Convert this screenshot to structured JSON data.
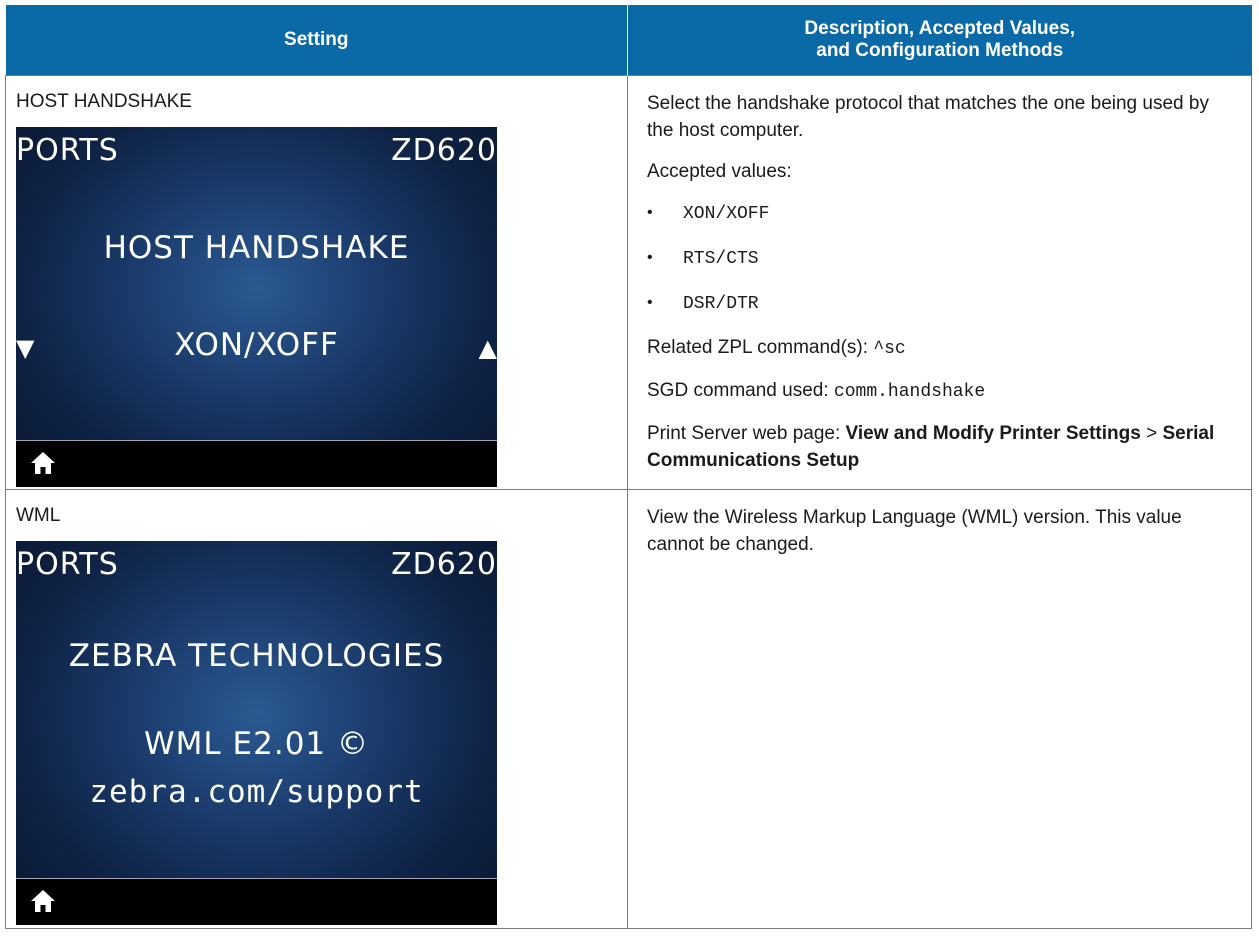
{
  "header": {
    "col1": "Setting",
    "col2_line1": "Description, Accepted Values,",
    "col2_line2": "and Configuration Methods"
  },
  "rows": [
    {
      "setting": "HOST HANDSHAKE",
      "screen": {
        "top_left": "PORTS",
        "top_right": "ZD620",
        "title": "HOST HANDSHAKE",
        "value": "XON/XOFF",
        "left_arrow": "▼",
        "right_arrow": "▲"
      },
      "description": "Select the handshake protocol that matches the one being used by the host computer.",
      "accepted_label": "Accepted values:",
      "values": [
        "XON/XOFF",
        "RTS/CTS",
        "DSR/DTR"
      ],
      "zpl_label": "Related ZPL command(s): ",
      "zpl_cmd": "^sc",
      "sgd_label": "SGD command used: ",
      "sgd_cmd": "comm.handshake",
      "web_label": "Print Server web page: ",
      "web_path_1": "View and Modify Printer Settings",
      "web_sep": " > ",
      "web_path_2": "Serial Communications Setup"
    },
    {
      "setting": "WML",
      "screen": {
        "top_left": "PORTS",
        "top_right": "ZD620",
        "line1": "ZEBRA TECHNOLOGIES",
        "line2": "WML E2.01 ©",
        "line3": "zebra.com/support"
      },
      "description": "View the Wireless Markup Language (WML) version. This value cannot be changed."
    }
  ],
  "icons": {
    "home": "home-icon",
    "bullet": "•"
  }
}
